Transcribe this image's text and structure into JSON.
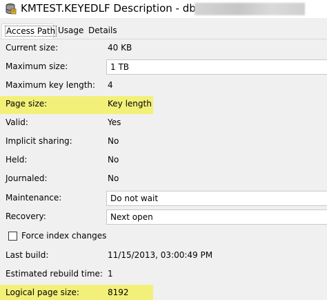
{
  "window": {
    "title": "KMTEST.KEYEDLF Description - db2icoe2"
  },
  "tabs": [
    {
      "label": "Access Path"
    },
    {
      "label": "Usage"
    },
    {
      "label": "Details"
    }
  ],
  "fields": {
    "current_size": {
      "label": "Current size:",
      "value": "40 KB"
    },
    "maximum_size": {
      "label": "Maximum size:",
      "value": "1 TB"
    },
    "maximum_key_length": {
      "label": "Maximum key length:",
      "value": "4"
    },
    "page_size": {
      "label": "Page size:",
      "value": "Key length"
    },
    "valid": {
      "label": "Valid:",
      "value": "Yes"
    },
    "implicit_sharing": {
      "label": "Implicit sharing:",
      "value": "No"
    },
    "held": {
      "label": "Held:",
      "value": "No"
    },
    "journaled": {
      "label": "Journaled:",
      "value": "No"
    },
    "maintenance": {
      "label": "Maintenance:",
      "value": "Do not wait"
    },
    "recovery": {
      "label": "Recovery:",
      "value": "Next open"
    },
    "force_index_changes": {
      "label": "Force index changes",
      "checked": false
    },
    "last_build": {
      "label": "Last build:",
      "value": "11/15/2013, 03:00:49 PM"
    },
    "estimated_rebuild_time": {
      "label": "Estimated rebuild time:",
      "value": "1"
    },
    "logical_page_size": {
      "label": "Logical page size:",
      "value": "8192"
    }
  },
  "colors": {
    "highlight": "#f3f07a",
    "background": "#f0f0f0",
    "field_border": "#c8c8c8"
  },
  "icons": {
    "app": "database-index-icon"
  }
}
